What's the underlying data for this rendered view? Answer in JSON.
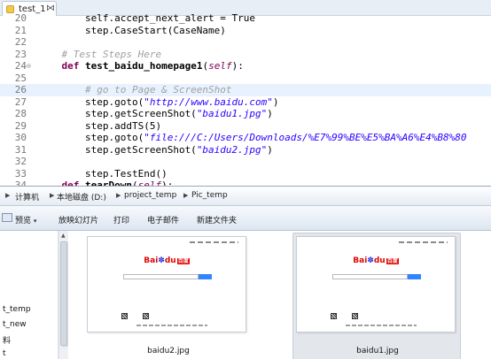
{
  "editor": {
    "tab": {
      "label": "test_1",
      "close": "⋈"
    },
    "lines": [
      {
        "num": "20",
        "fold": "",
        "current": false,
        "tokens": [
          {
            "t": "        self.accept_next_alert = True",
            "c": "nm"
          }
        ]
      },
      {
        "num": "21",
        "fold": "",
        "current": false,
        "tokens": [
          {
            "t": "        step.CaseStart(CaseName)",
            "c": "nm"
          }
        ]
      },
      {
        "num": "22",
        "fold": "",
        "current": false,
        "tokens": []
      },
      {
        "num": "23",
        "fold": "",
        "current": false,
        "tokens": [
          {
            "t": "    # Test Steps Here",
            "c": "cm"
          }
        ]
      },
      {
        "num": "24",
        "fold": "⊖",
        "current": false,
        "tokens": [
          {
            "t": "    ",
            "c": "nm"
          },
          {
            "t": "def",
            "c": "kw"
          },
          {
            "t": " ",
            "c": "nm"
          },
          {
            "t": "test_baidu_homepage1",
            "c": "fn"
          },
          {
            "t": "(",
            "c": "nm"
          },
          {
            "t": "self",
            "c": "slf"
          },
          {
            "t": "):",
            "c": "nm"
          }
        ]
      },
      {
        "num": "25",
        "fold": "",
        "current": false,
        "tokens": []
      },
      {
        "num": "26",
        "fold": "",
        "current": true,
        "tokens": [
          {
            "t": "        # go to Page & ScreenShot",
            "c": "cm"
          }
        ]
      },
      {
        "num": "27",
        "fold": "",
        "current": false,
        "tokens": [
          {
            "t": "        step.goto(",
            "c": "nm"
          },
          {
            "t": "\"http://www.baidu.com\"",
            "c": "st"
          },
          {
            "t": ")",
            "c": "nm"
          }
        ]
      },
      {
        "num": "28",
        "fold": "",
        "current": false,
        "tokens": [
          {
            "t": "        step.getScreenShot(",
            "c": "nm"
          },
          {
            "t": "\"baidu1.jpg\"",
            "c": "st"
          },
          {
            "t": ")",
            "c": "nm"
          }
        ]
      },
      {
        "num": "29",
        "fold": "",
        "current": false,
        "tokens": [
          {
            "t": "        step.addTS(5)",
            "c": "nm"
          }
        ]
      },
      {
        "num": "30",
        "fold": "",
        "current": false,
        "tokens": [
          {
            "t": "        step.goto(",
            "c": "nm"
          },
          {
            "t": "\"file:///C:/Users/Downloads/%E7%99%BE%E5%BA%A6%E4%B8%80",
            "c": "st"
          }
        ]
      },
      {
        "num": "31",
        "fold": "",
        "current": false,
        "tokens": [
          {
            "t": "        step.getScreenShot(",
            "c": "nm"
          },
          {
            "t": "\"baidu2.jpg\"",
            "c": "st"
          },
          {
            "t": ")",
            "c": "nm"
          }
        ]
      },
      {
        "num": "32",
        "fold": "",
        "current": false,
        "tokens": []
      },
      {
        "num": "33",
        "fold": "",
        "current": false,
        "tokens": [
          {
            "t": "        step.TestEnd()",
            "c": "nm"
          }
        ]
      },
      {
        "num": "34",
        "fold": "",
        "current": false,
        "tokens": [
          {
            "t": "    ",
            "c": "nm"
          },
          {
            "t": "def",
            "c": "kw"
          },
          {
            "t": " ",
            "c": "nm"
          },
          {
            "t": "tearDown",
            "c": "fn"
          },
          {
            "t": "(",
            "c": "nm"
          },
          {
            "t": "self",
            "c": "slf"
          },
          {
            "t": "):",
            "c": "nm"
          }
        ]
      }
    ]
  },
  "explorer": {
    "breadcrumb": [
      "计算机",
      "本地磁盘 (D:)",
      "project_temp",
      "Pic_temp"
    ],
    "toolbar": {
      "preview": "预览",
      "slideshow": "放映幻灯片",
      "print": "打印",
      "email": "电子邮件",
      "new_folder": "新建文件夹"
    },
    "sidebar": [
      "t_temp",
      "t_new",
      "料",
      "t"
    ],
    "files": [
      {
        "name": "baidu2.jpg",
        "selected": false
      },
      {
        "name": "baidu1.jpg",
        "selected": true
      }
    ],
    "baidu_logo": {
      "part1": "Bai",
      "part2": "du",
      "part3": "百度"
    }
  },
  "colors": {
    "keyword": "#7f0055",
    "string": "#2a00ff",
    "comment": "#a0a0a0",
    "current_line": "#e8f2fe",
    "baidu_red": "#e10602",
    "baidu_blue": "#2932e1"
  }
}
